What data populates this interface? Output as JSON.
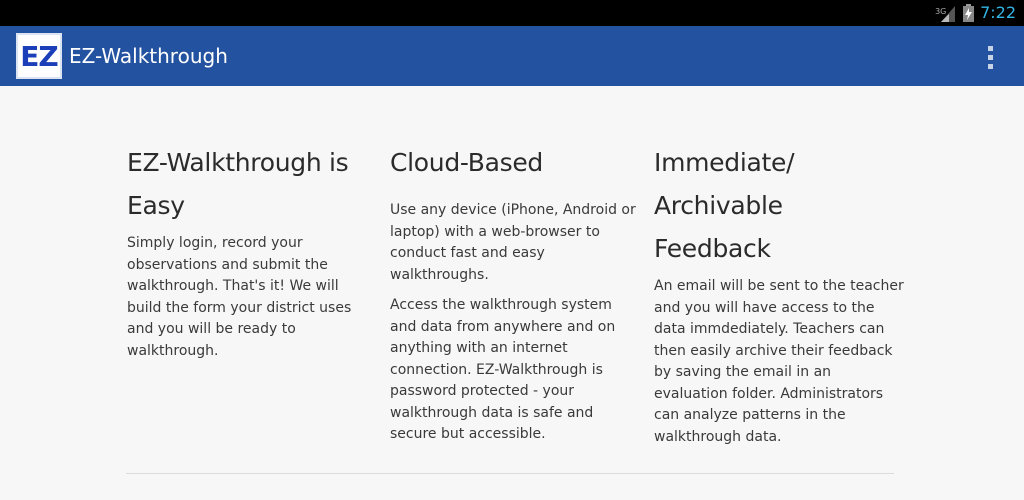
{
  "status_bar": {
    "network_label": "3G",
    "time": "7:22"
  },
  "action_bar": {
    "logo_text": "EZ",
    "title": "EZ-Walkthrough",
    "brand_color": "#2352a0"
  },
  "columns": [
    {
      "heading": "EZ-Walkthrough is Easy",
      "paragraphs": [
        "Simply login, record your observations and submit the walkthrough. That's it! We will build the form your district uses and you will be ready to walkthrough."
      ]
    },
    {
      "heading": "Cloud-Based",
      "paragraphs": [
        "Use any device (iPhone, Android or laptop) with a web-browser to conduct fast and easy walkthroughs.",
        "Access the walkthrough system and data from anywhere and on anything with an internet connection. EZ-Walkthrough is password protected - your walkthrough data is safe and secure but accessible."
      ]
    },
    {
      "heading": "Immediate/ Archivable Feedback",
      "paragraphs": [
        "An email will be sent to the teacher and you will have access to the data immdediately. Teachers can then easily archive their feedback by saving the email in an evaluation folder. Administrators can analyze patterns in the walkthrough data."
      ]
    }
  ]
}
